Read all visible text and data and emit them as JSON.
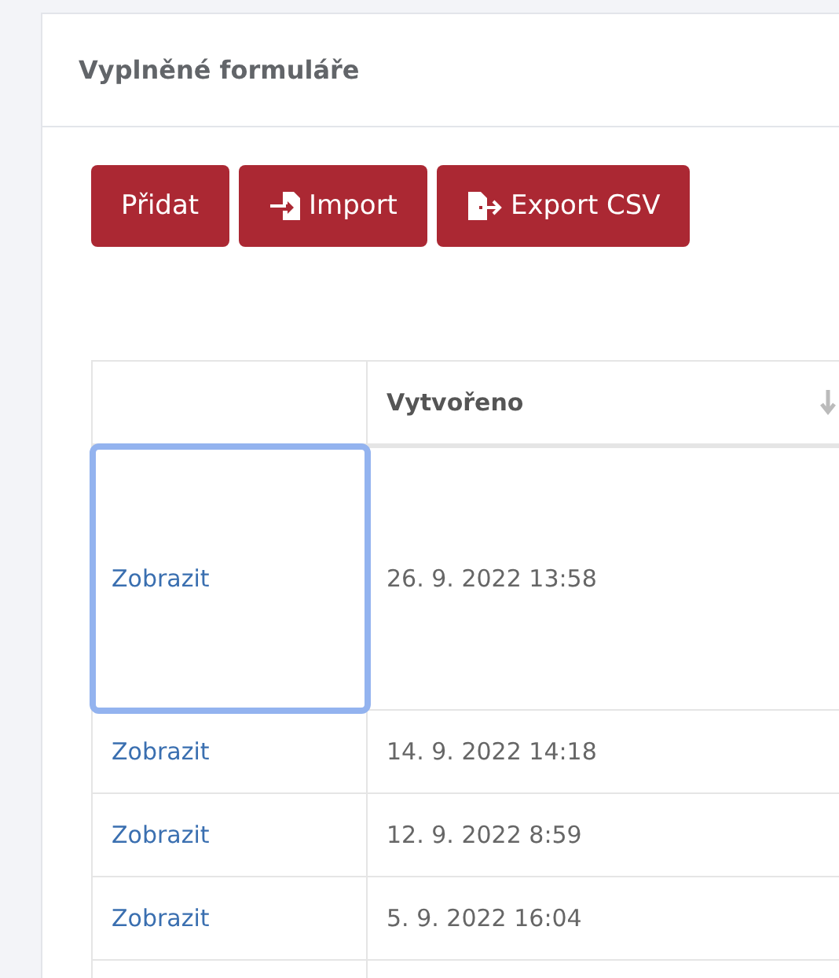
{
  "card": {
    "title": "Vyplněné formuláře"
  },
  "buttons": [
    {
      "label": "Přidat",
      "kind": "plain"
    },
    {
      "label": "Import",
      "kind": "import"
    },
    {
      "label": "Export CSV",
      "kind": "export"
    }
  ],
  "table": {
    "columns": [
      {},
      {
        "label": "Vytvořeno",
        "sorted": true
      }
    ],
    "rows": [
      {
        "link": "Zobrazit",
        "created": "26. 9. 2022 13:58",
        "focused": true
      },
      {
        "link": "Zobrazit",
        "created": "14. 9. 2022 14:18",
        "focused": false
      },
      {
        "link": "Zobrazit",
        "created": "12. 9. 2022 8:59",
        "focused": false
      },
      {
        "link": "Zobrazit",
        "created": "5. 9. 2022 16:04",
        "focused": false
      }
    ]
  }
}
